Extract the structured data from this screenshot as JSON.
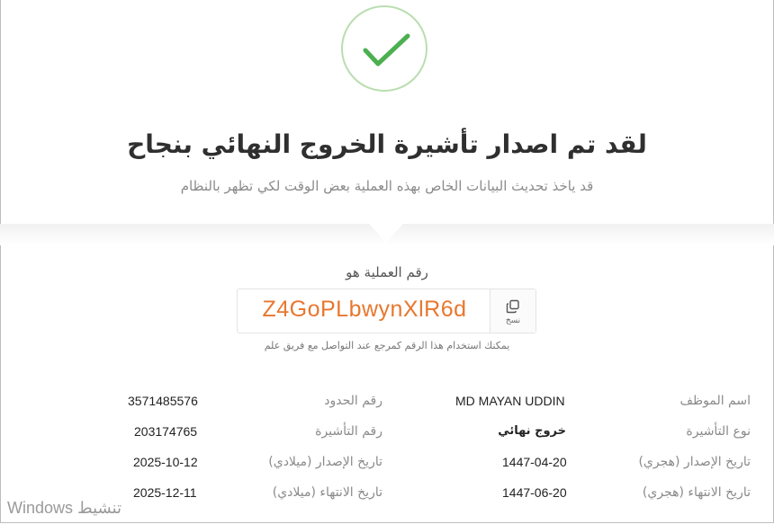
{
  "header": {
    "title": "لقد تم اصدار تأشيرة الخروج النهائي بنجاح",
    "subtitle": "قد ياخذ تحديث البيانات الخاص بهذه العملية بعض الوقت لكي تظهر بالنظام"
  },
  "transaction": {
    "label": "رقم العملية هو",
    "code": "Z4GoPLbwynXlR6d",
    "copy_label": "نسخ",
    "hint": "يمكنك استخدام هذا الرقم كمرجع عند التواصل مع فريق علم"
  },
  "details": {
    "employee_name_label": "اسم الموظف",
    "employee_name": "MD MAYAN UDDIN",
    "border_number_label": "رقم الحدود",
    "border_number": "3571485576",
    "visa_type_label": "نوع التأشيرة",
    "visa_type": "خروج نهائي",
    "visa_number_label": "رقم التأشيرة",
    "visa_number": "203174765",
    "issue_hijri_label": "تاريخ الإصدار (هجري)",
    "issue_hijri": "1447-04-20",
    "issue_gregorian_label": "تاريخ الإصدار (ميلادي)",
    "issue_gregorian": "2025-10-12",
    "expiry_hijri_label": "تاريخ الانتهاء (هجري)",
    "expiry_hijri": "1447-06-20",
    "expiry_gregorian_label": "تاريخ الانتهاء (ميلادي)",
    "expiry_gregorian": "2025-12-11"
  },
  "watermark": "Windows تنشيط",
  "colors": {
    "accent_orange": "#e8772e",
    "success_green": "#4caf50"
  }
}
